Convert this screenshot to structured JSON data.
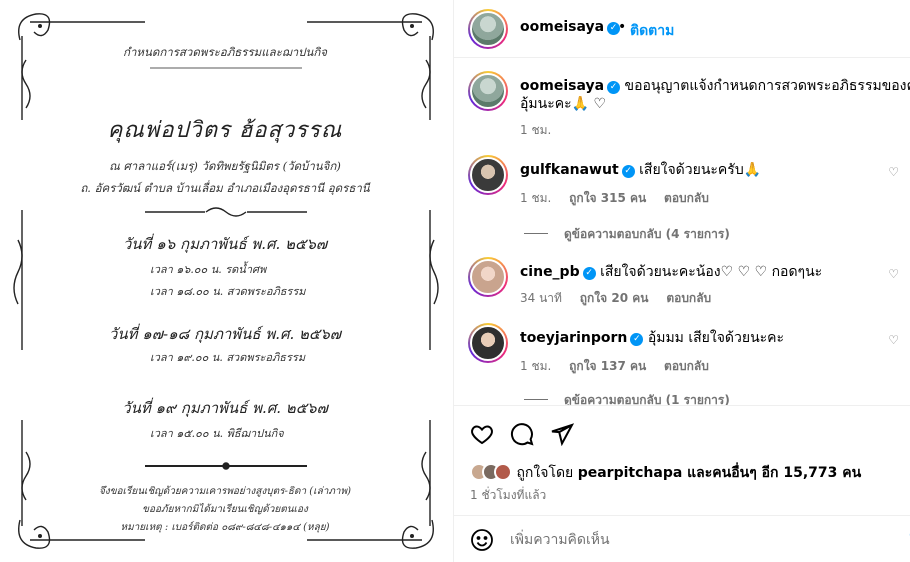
{
  "invitation": {
    "header": "กำหนดการสวดพระอภิธรรมและฌาปนกิจ",
    "name": "คุณพ่อปวิตร ฮ้อสุวรรณ",
    "place_line1": "ณ ศาลาแอร์(เมรุ) วัดทิพยรัฐนิมิตร (วัดบ้านจิก)",
    "place_line2": "ถ. อัครวัฒน์ ตำบล บ้านเลื่อม อำเภอเมืองอุดรธานี อุดรธานี",
    "sections": [
      {
        "date": "วันที่ ๑๖ กุมภาพันธ์ พ.ศ. ๒๕๖๗",
        "times": [
          "เวลา ๑๖.๐๐ น. รดน้ำศพ",
          "เวลา ๑๘.๐๐ น. สวดพระอภิธรรม"
        ]
      },
      {
        "date": "วันที่ ๑๗-๑๘ กุมภาพันธ์ พ.ศ. ๒๕๖๗",
        "times": [
          "เวลา ๑๙.๐๐ น. สวดพระอภิธรรม"
        ]
      },
      {
        "date": "วันที่ ๑๙ กุมภาพันธ์ พ.ศ. ๒๕๖๗",
        "times": [
          "เวลา ๑๕.๐๐ น. พิธีฌาปนกิจ"
        ]
      }
    ],
    "footer_line1": "จึงขอเรียนเชิญด้วยความเคารพอย่างสูงบุตร-ธิดา (เล่าภาพ)",
    "footer_line2": "ขออภัยหากมิได้มาเรียนเชิญด้วยตนเอง",
    "footer_line3": "หมายเหตุ : เบอร์ติดต่อ ๐๘๙-๘๔๘-๔๑๑๔ (หลุย)"
  },
  "post": {
    "author": "oomeisaya",
    "follow_label": "ติดตาม",
    "dot": "•"
  },
  "comments": [
    {
      "username": "oomeisaya",
      "verified": true,
      "text": "ขออนุญาตแจ้งกำหนดการสวดพระอภิธรรมของคุณพ่อ",
      "text2": "อุ้มนะคะ🙏 ♡",
      "time": "1 ชม.",
      "likes": "",
      "reply_label": ""
    },
    {
      "username": "gulfkanawut",
      "verified": true,
      "text": "เสียใจด้วยนะครับ🙏",
      "time": "1 ชม.",
      "likes": "ถูกใจ 315 คน",
      "reply_label": "ตอบกลับ",
      "view_replies": "ดูข้อความตอบกลับ (4 รายการ)"
    },
    {
      "username": "cine_pb",
      "verified": true,
      "text": "เสียใจด้วยนะคะน้อง♡ ♡ ♡  กอดๆนะ",
      "time": "34 นาที",
      "likes": "ถูกใจ 20 คน",
      "reply_label": "ตอบกลับ"
    },
    {
      "username": "toeyjarinporn",
      "verified": true,
      "text": "อุ้มมม เสียใจด้วยนะคะ",
      "time": "1 ชม.",
      "likes": "ถูกใจ 137 คน",
      "reply_label": "ตอบกลับ",
      "view_replies": "ดูข้อความตอบกลับ (1 รายการ)"
    }
  ],
  "likes_summary": {
    "prefix": "ถูกใจโดย ",
    "user": "pearpitchapa",
    "suffix": " และคนอื่นๆ อีก 15,773 คน"
  },
  "time_ago": "1 ชั่วโมงที่แล้ว",
  "comment_box": {
    "placeholder": "เพิ่มความคิดเห็น",
    "post_label": "โ"
  },
  "colors": {
    "accent": "#0095f6",
    "muted": "#737373",
    "border": "#efefef"
  }
}
